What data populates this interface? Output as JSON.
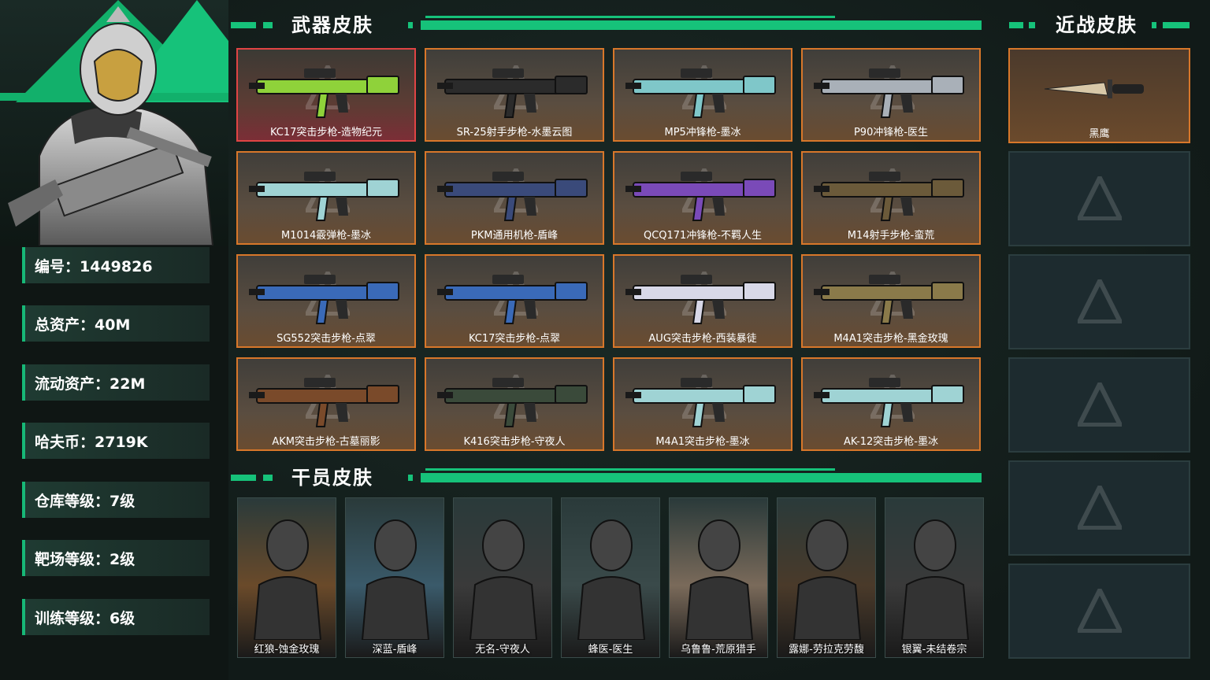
{
  "player": {
    "id_label": "编号：1449826",
    "total_assets": "总资产：40M",
    "liquid_assets": "流动资产：22M",
    "havoc_coins": "哈夫币：2719K",
    "warehouse_level": "仓库等级：7级",
    "range_level": "靶场等级：2级",
    "training_level": "训练等级：6级"
  },
  "sections": {
    "weapon_skins": "武器皮肤",
    "operator_skins": "干员皮肤",
    "melee_skins": "近战皮肤"
  },
  "weapons": [
    {
      "name": "KC17突击步枪-造物纪元",
      "rarity": "red",
      "color": "#8fd23a"
    },
    {
      "name": "SR-25射手步枪-水墨云图",
      "rarity": "orange",
      "color": "#2b2b2b"
    },
    {
      "name": "MP5冲锋枪-墨冰",
      "rarity": "orange",
      "color": "#7fc7c9"
    },
    {
      "name": "P90冲锋枪-医生",
      "rarity": "orange",
      "color": "#a9b0b8"
    },
    {
      "name": "M1014霰弹枪-墨冰",
      "rarity": "orange",
      "color": "#9fd3d4"
    },
    {
      "name": "PKM通用机枪-盾峰",
      "rarity": "orange",
      "color": "#3a4a7a"
    },
    {
      "name": "QCQ171冲锋枪-不羁人生",
      "rarity": "orange",
      "color": "#7a4ab8"
    },
    {
      "name": "M14射手步枪-蛮荒",
      "rarity": "orange",
      "color": "#6b5a3a"
    },
    {
      "name": "SG552突击步枪-点翠",
      "rarity": "orange",
      "color": "#3a6ab8"
    },
    {
      "name": "KC17突击步枪-点翠",
      "rarity": "orange",
      "color": "#3a6ab8"
    },
    {
      "name": "AUG突击步枪-西装暴徒",
      "rarity": "orange",
      "color": "#d8d8e8"
    },
    {
      "name": "M4A1突击步枪-黑金玫瑰",
      "rarity": "orange",
      "color": "#8a7a4a"
    },
    {
      "name": "AKM突击步枪-古墓丽影",
      "rarity": "orange",
      "color": "#7a4a2a"
    },
    {
      "name": "K416突击步枪-守夜人",
      "rarity": "orange",
      "color": "#3a4a3a"
    },
    {
      "name": "M4A1突击步枪-墨冰",
      "rarity": "orange",
      "color": "#9fd3d4"
    },
    {
      "name": "AK-12突击步枪-墨冰",
      "rarity": "orange",
      "color": "#9fd3d4"
    }
  ],
  "melee": [
    {
      "name": "黑鹰",
      "active": true
    },
    {
      "name": "",
      "active": false
    },
    {
      "name": "",
      "active": false
    },
    {
      "name": "",
      "active": false
    },
    {
      "name": "",
      "active": false
    },
    {
      "name": "",
      "active": false
    }
  ],
  "operators": [
    {
      "name": "红狼-蚀金玫瑰",
      "color": "#6a4a2a"
    },
    {
      "name": "深蓝-盾峰",
      "color": "#3a5a6a"
    },
    {
      "name": "无名-守夜人",
      "color": "#3a3a3a"
    },
    {
      "name": "蜂医-医生",
      "color": "#3a4a4a"
    },
    {
      "name": "乌鲁鲁-荒原猎手",
      "color": "#7a6a5a"
    },
    {
      "name": "露娜-劳拉克劳馥",
      "color": "#4a3a2a"
    },
    {
      "name": "银翼-未结卷宗",
      "color": "#3a3a3a"
    }
  ],
  "colors": {
    "accent": "#16c27a",
    "orange_border": "#d8772a",
    "red_border": "#e04444"
  }
}
